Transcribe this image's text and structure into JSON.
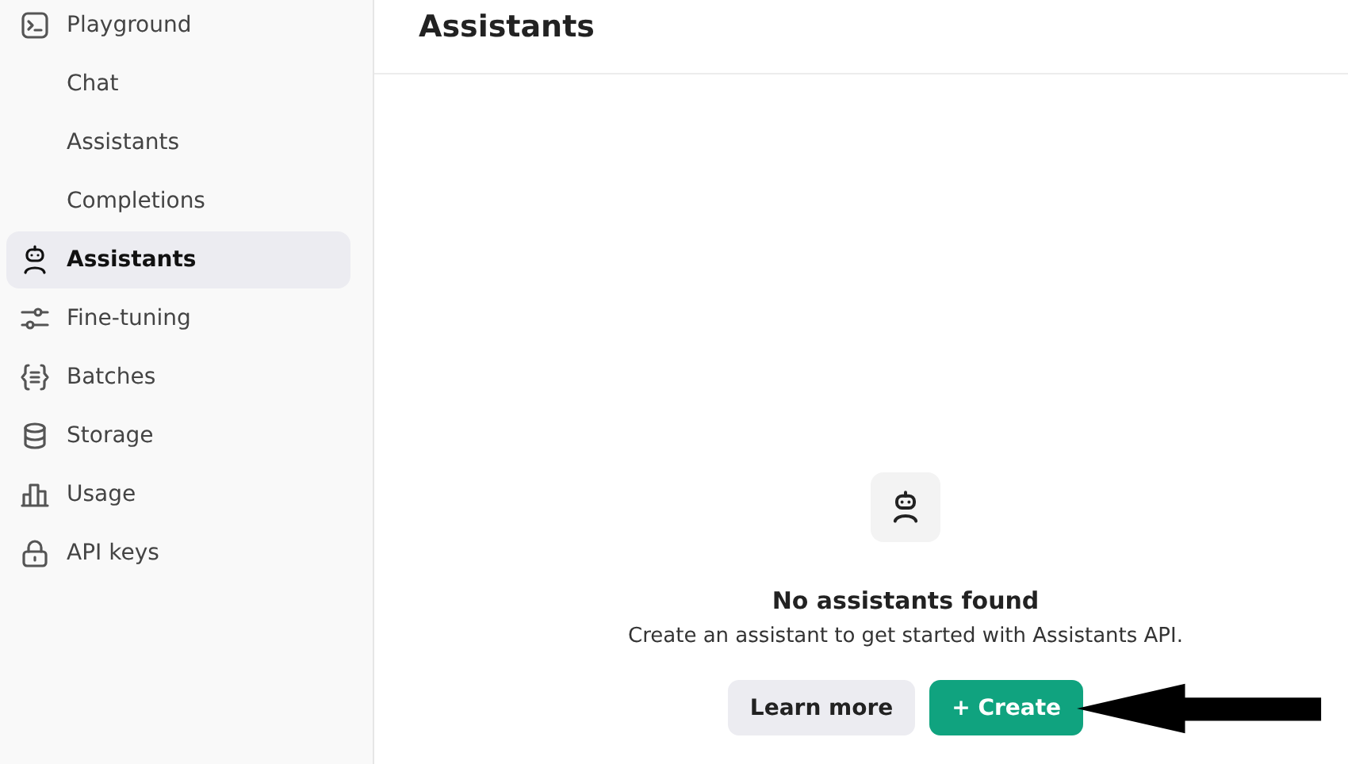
{
  "sidebar": {
    "items": [
      {
        "label": "Playground",
        "kind": "section",
        "selected": false
      },
      {
        "label": "Chat",
        "kind": "sub",
        "selected": false
      },
      {
        "label": "Assistants",
        "kind": "sub",
        "selected": false
      },
      {
        "label": "Completions",
        "kind": "sub",
        "selected": false
      },
      {
        "label": "Assistants",
        "kind": "section",
        "selected": true
      },
      {
        "label": "Fine-tuning",
        "kind": "section",
        "selected": false
      },
      {
        "label": "Batches",
        "kind": "section",
        "selected": false
      },
      {
        "label": "Storage",
        "kind": "section",
        "selected": false
      },
      {
        "label": "Usage",
        "kind": "section",
        "selected": false
      },
      {
        "label": "API keys",
        "kind": "section",
        "selected": false
      }
    ]
  },
  "page": {
    "title": "Assistants"
  },
  "empty_state": {
    "title": "No assistants found",
    "message": "Create an assistant to get started with Assistants API.",
    "buttons": [
      {
        "label": "Learn more",
        "kind": "secondary"
      },
      {
        "label": "+ Create",
        "kind": "primary"
      }
    ]
  }
}
